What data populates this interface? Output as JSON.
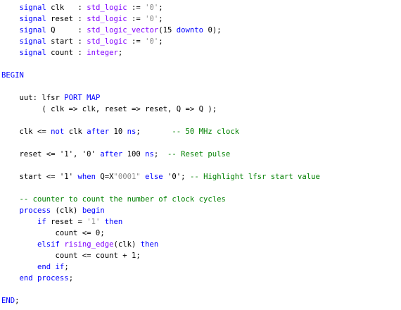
{
  "editor": {
    "language": "VHDL",
    "colors": {
      "default": "#000000",
      "keyword": "#0000ff",
      "type": "#8000ff",
      "literal": "#8a8a8a",
      "comment": "#008000",
      "background": "#ffffff"
    },
    "lines": [
      [
        {
          "t": "    "
        },
        {
          "t": "signal",
          "k": "keyword"
        },
        {
          "t": " clk   : "
        },
        {
          "t": "std_logic",
          "k": "type"
        },
        {
          "t": " := "
        },
        {
          "t": "'0'",
          "k": "literal"
        },
        {
          "t": ";"
        }
      ],
      [
        {
          "t": "    "
        },
        {
          "t": "signal",
          "k": "keyword"
        },
        {
          "t": " reset : "
        },
        {
          "t": "std_logic",
          "k": "type"
        },
        {
          "t": " := "
        },
        {
          "t": "'0'",
          "k": "literal"
        },
        {
          "t": ";"
        }
      ],
      [
        {
          "t": "    "
        },
        {
          "t": "signal",
          "k": "keyword"
        },
        {
          "t": " Q     : "
        },
        {
          "t": "std_logic_vector",
          "k": "type"
        },
        {
          "t": "(15 "
        },
        {
          "t": "downto",
          "k": "keyword"
        },
        {
          "t": " 0);"
        }
      ],
      [
        {
          "t": "    "
        },
        {
          "t": "signal",
          "k": "keyword"
        },
        {
          "t": " start : "
        },
        {
          "t": "std_logic",
          "k": "type"
        },
        {
          "t": " := "
        },
        {
          "t": "'0'",
          "k": "literal"
        },
        {
          "t": ";"
        }
      ],
      [
        {
          "t": "    "
        },
        {
          "t": "signal",
          "k": "keyword"
        },
        {
          "t": " count : "
        },
        {
          "t": "integer",
          "k": "type"
        },
        {
          "t": ";"
        }
      ],
      [],
      [
        {
          "t": "BEGIN",
          "k": "keyword"
        }
      ],
      [],
      [
        {
          "t": "    uut: lfsr "
        },
        {
          "t": "PORT MAP",
          "k": "keyword"
        }
      ],
      [
        {
          "t": "         ( clk => clk, reset => reset, Q => Q );"
        }
      ],
      [],
      [
        {
          "t": "    clk <= "
        },
        {
          "t": "not",
          "k": "keyword"
        },
        {
          "t": " clk "
        },
        {
          "t": "after",
          "k": "keyword"
        },
        {
          "t": " 10 "
        },
        {
          "t": "ns",
          "k": "keyword"
        },
        {
          "t": ";       "
        },
        {
          "t": "-- 50 MHz clock",
          "k": "comment"
        }
      ],
      [],
      [
        {
          "t": "    reset <= '1', '0' "
        },
        {
          "t": "after",
          "k": "keyword"
        },
        {
          "t": " 100 "
        },
        {
          "t": "ns",
          "k": "keyword"
        },
        {
          "t": ";  "
        },
        {
          "t": "-- Reset pulse",
          "k": "comment"
        }
      ],
      [],
      [
        {
          "t": "    start <= '1' "
        },
        {
          "t": "when",
          "k": "keyword"
        },
        {
          "t": " Q=X"
        },
        {
          "t": "\"0001\"",
          "k": "literal"
        },
        {
          "t": " "
        },
        {
          "t": "else",
          "k": "keyword"
        },
        {
          "t": " '0'; "
        },
        {
          "t": "-- Highlight lfsr start value",
          "k": "comment"
        }
      ],
      [],
      [
        {
          "t": "    "
        },
        {
          "t": "-- counter to count the number of clock cycles",
          "k": "comment"
        }
      ],
      [
        {
          "t": "    "
        },
        {
          "t": "process",
          "k": "keyword"
        },
        {
          "t": " (clk) "
        },
        {
          "t": "begin",
          "k": "keyword"
        }
      ],
      [
        {
          "t": "        "
        },
        {
          "t": "if",
          "k": "keyword"
        },
        {
          "t": " reset = "
        },
        {
          "t": "'1'",
          "k": "literal"
        },
        {
          "t": " "
        },
        {
          "t": "then",
          "k": "keyword"
        }
      ],
      [
        {
          "t": "            count <= 0;"
        }
      ],
      [
        {
          "t": "        "
        },
        {
          "t": "elsif",
          "k": "keyword"
        },
        {
          "t": " "
        },
        {
          "t": "rising_edge",
          "k": "type"
        },
        {
          "t": "(clk) "
        },
        {
          "t": "then",
          "k": "keyword"
        }
      ],
      [
        {
          "t": "            count <= count + 1;"
        }
      ],
      [
        {
          "t": "        "
        },
        {
          "t": "end if",
          "k": "keyword"
        },
        {
          "t": ";"
        }
      ],
      [
        {
          "t": "    "
        },
        {
          "t": "end process",
          "k": "keyword"
        },
        {
          "t": ";"
        }
      ],
      [],
      [
        {
          "t": "END",
          "k": "keyword"
        },
        {
          "t": ";"
        }
      ]
    ]
  }
}
